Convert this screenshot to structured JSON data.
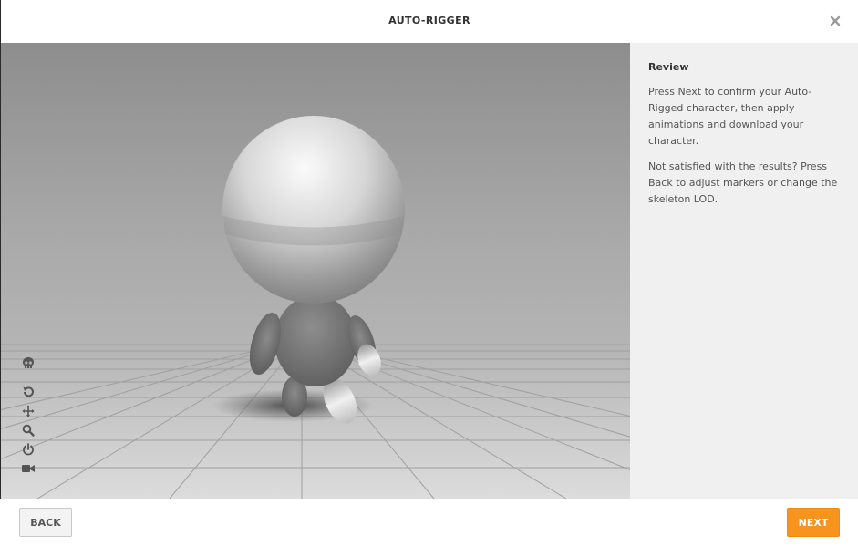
{
  "header": {
    "title": "AUTO-RIGGER",
    "close_icon": "close-icon"
  },
  "viewport": {
    "tools": [
      {
        "name": "skeleton",
        "icon": "skull-icon"
      },
      {
        "name": "reset-view",
        "icon": "rotate-icon"
      },
      {
        "name": "pan",
        "icon": "move-icon"
      },
      {
        "name": "zoom",
        "icon": "magnifier-icon"
      },
      {
        "name": "power",
        "icon": "power-icon"
      },
      {
        "name": "camera",
        "icon": "video-camera-icon"
      }
    ]
  },
  "panel": {
    "title": "Review",
    "paragraph_1": "Press Next to confirm your Auto-Rigged character, then apply animations and download your character.",
    "paragraph_2": "Not satisfied with the results? Press Back to adjust markers or change the skeleton LOD."
  },
  "footer": {
    "back_label": "BACK",
    "next_label": "NEXT"
  },
  "colors": {
    "accent": "#f7941e",
    "panel_bg": "#f0f0f0",
    "viewport_bg": "#8c8c8c"
  }
}
